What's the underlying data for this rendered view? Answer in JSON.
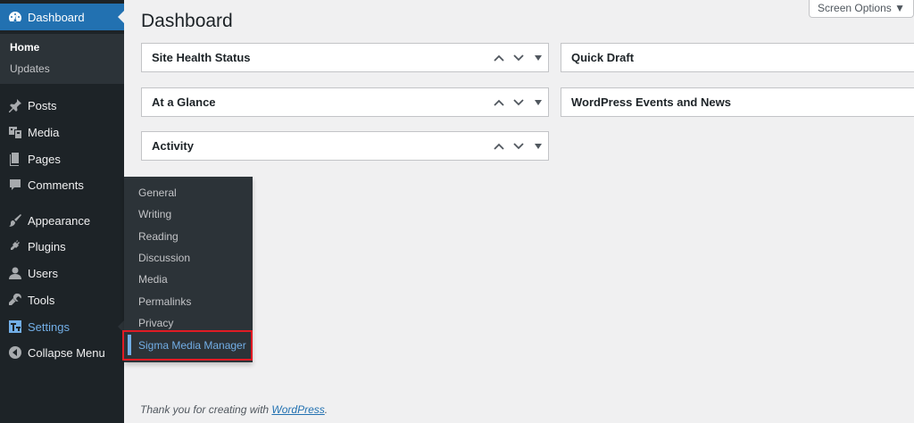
{
  "sidebar": {
    "dashboard": "Dashboard",
    "submenu": [
      "Home",
      "Updates"
    ],
    "items": [
      {
        "label": "Posts",
        "icon": "pin-icon"
      },
      {
        "label": "Media",
        "icon": "media-icon"
      },
      {
        "label": "Pages",
        "icon": "pages-icon"
      },
      {
        "label": "Comments",
        "icon": "comment-icon"
      },
      {
        "label": "Appearance",
        "icon": "paintbrush-icon"
      },
      {
        "label": "Plugins",
        "icon": "plugin-icon"
      },
      {
        "label": "Users",
        "icon": "user-icon"
      },
      {
        "label": "Tools",
        "icon": "wrench-icon"
      },
      {
        "label": "Settings",
        "icon": "settings-icon"
      },
      {
        "label": "Collapse Menu",
        "icon": "collapse-icon"
      }
    ]
  },
  "flyout": {
    "items": [
      "General",
      "Writing",
      "Reading",
      "Discussion",
      "Media",
      "Permalinks",
      "Privacy",
      "Sigma Media Manager"
    ]
  },
  "main": {
    "title": "Dashboard",
    "screen_options": "Screen Options ▼",
    "left_panels": [
      "Site Health Status",
      "At a Glance",
      "Activity"
    ],
    "right_panels": [
      "Quick Draft",
      "WordPress Events and News"
    ]
  },
  "footer": {
    "text": "Thank you for creating with ",
    "link": "WordPress",
    "end": "."
  },
  "colors": {
    "sidebar_bg": "#1d2327",
    "accent": "#2271b1",
    "highlight_border": "#e01b24",
    "active_link": "#72aee6"
  }
}
